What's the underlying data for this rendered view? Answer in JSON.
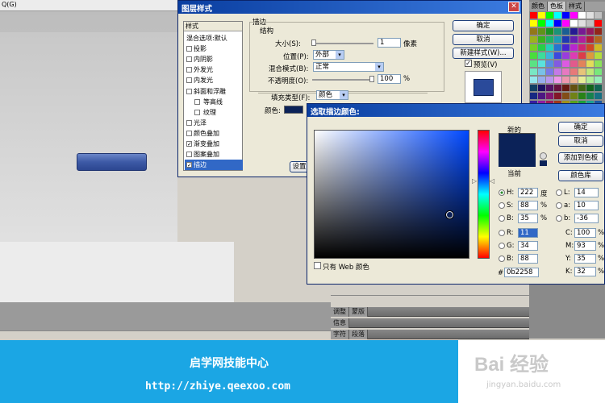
{
  "tabs_fragment": "Q(G)",
  "layer_style": {
    "title": "图层样式",
    "sidebar_header": "样式",
    "items": [
      {
        "label": "混合选项:默认",
        "checkbox": false,
        "checked": false
      },
      {
        "label": "投影",
        "checkbox": true,
        "checked": false
      },
      {
        "label": "内阴影",
        "checkbox": true,
        "checked": false
      },
      {
        "label": "外发光",
        "checkbox": true,
        "checked": false
      },
      {
        "label": "内发光",
        "checkbox": true,
        "checked": false
      },
      {
        "label": "斜面和浮雕",
        "checkbox": true,
        "checked": false
      },
      {
        "label": "等高线",
        "checkbox": true,
        "checked": false
      },
      {
        "label": "纹理",
        "checkbox": true,
        "checked": false
      },
      {
        "label": "光泽",
        "checkbox": true,
        "checked": false
      },
      {
        "label": "颜色叠加",
        "checkbox": true,
        "checked": false
      },
      {
        "label": "渐变叠加",
        "checkbox": true,
        "checked": true
      },
      {
        "label": "图案叠加",
        "checkbox": true,
        "checked": false
      },
      {
        "label": "描边",
        "checkbox": true,
        "checked": true,
        "selected": true
      }
    ],
    "stroke": {
      "group": "描边",
      "structure": "结构",
      "size_label": "大小(S):",
      "size_value": "1",
      "size_unit": "像素",
      "position_label": "位置(P):",
      "position_value": "外部",
      "blend_label": "混合模式(B):",
      "blend_value": "正常",
      "opacity_label": "不透明度(O):",
      "opacity_value": "100",
      "opacity_unit": "%",
      "fill_type_label": "填充类型(F):",
      "fill_type_value": "颜色",
      "color_label": "颜色:",
      "setting_btn": "设置"
    },
    "buttons": {
      "ok": "确定",
      "cancel": "取消",
      "new_style": "新建样式(W)...",
      "preview": "预览(V)"
    },
    "preview_checked": true
  },
  "color_picker": {
    "title": "选取描边颜色:",
    "new_label": "新的",
    "current_label": "当前",
    "new_color": "#0b2258",
    "current_color": "#0b2258",
    "buttons": {
      "ok": "确定",
      "cancel": "取消",
      "add_swatch": "添加到色板",
      "libraries": "颜色库"
    },
    "web_only": "只有 Web 颜色",
    "hsb": [
      {
        "label": "H:",
        "value": "222",
        "unit": "度",
        "checked": true
      },
      {
        "label": "S:",
        "value": "88",
        "unit": "%",
        "checked": false
      },
      {
        "label": "B:",
        "value": "35",
        "unit": "%",
        "checked": false
      }
    ],
    "rgb": [
      {
        "label": "R:",
        "value": "11",
        "checked": false
      },
      {
        "label": "G:",
        "value": "34",
        "checked": false
      },
      {
        "label": "B:",
        "value": "88",
        "checked": false
      }
    ],
    "lab": [
      {
        "label": "L:",
        "value": "14"
      },
      {
        "label": "a:",
        "value": "10"
      },
      {
        "label": "b:",
        "value": "-36"
      }
    ],
    "cmyk": [
      {
        "label": "C:",
        "value": "100",
        "unit": "%"
      },
      {
        "label": "M:",
        "value": "93",
        "unit": "%"
      },
      {
        "label": "Y:",
        "value": "35",
        "unit": "%"
      },
      {
        "label": "K:",
        "value": "32",
        "unit": "%"
      }
    ],
    "hex_label": "#",
    "hex_value": "0b2258"
  },
  "panels": {
    "top_tabs": [
      "颜色",
      "色板",
      "样式"
    ],
    "rows": [
      {
        "tabs": [
          "调整",
          "蒙版"
        ]
      },
      {
        "tabs": [
          "信息"
        ]
      },
      {
        "tabs": [
          "字符",
          "段落"
        ]
      }
    ]
  },
  "footer": {
    "title": "启学网技能中心",
    "url": "http://zhiye.qeexoo.com",
    "watermark_logo": "Bai 经验",
    "watermark_url": "jingyan.baidu.com"
  },
  "colors": {
    "footer_bg": "#1ba6e4",
    "title_blue": "#0a3ea0",
    "stroke_color": "#0b2258"
  }
}
